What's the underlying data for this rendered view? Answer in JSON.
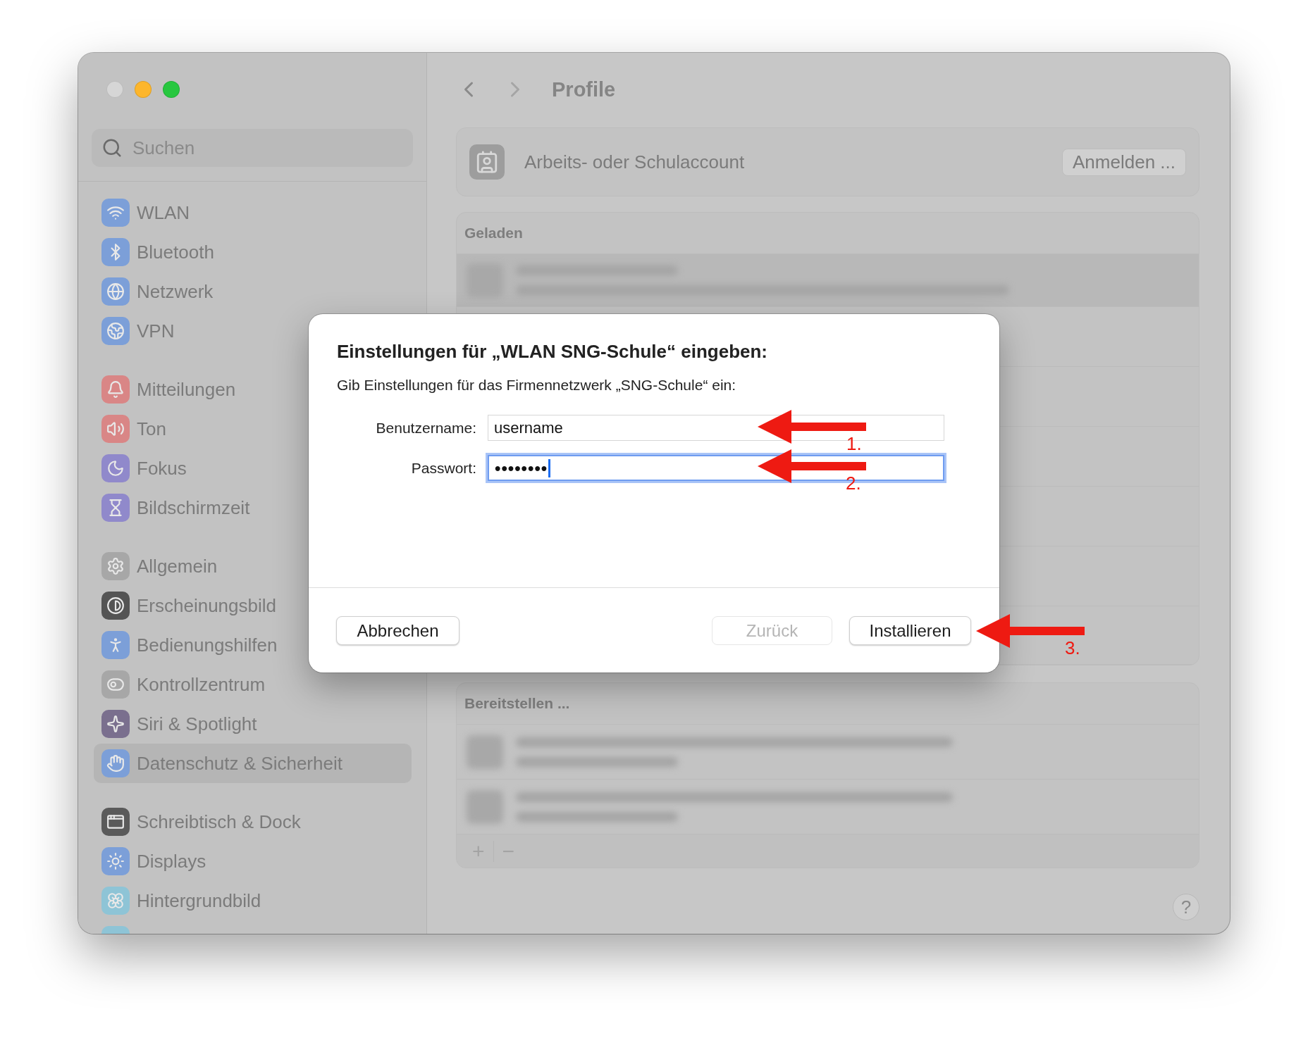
{
  "sidebar": {
    "search": {
      "placeholder": "Suchen"
    },
    "groups": [
      {
        "items": [
          {
            "label": "WLAN",
            "color": "#7c9fd8",
            "selected": false
          },
          {
            "label": "Bluetooth",
            "color": "#7c9fd8",
            "selected": false
          },
          {
            "label": "Netzwerk",
            "color": "#7c9fd8",
            "selected": false
          },
          {
            "label": "VPN",
            "color": "#7c9fd8",
            "selected": false
          }
        ]
      },
      {
        "items": [
          {
            "label": "Mitteilungen",
            "color": "#d98686",
            "selected": false
          },
          {
            "label": "Ton",
            "color": "#d98686",
            "selected": false
          },
          {
            "label": "Fokus",
            "color": "#9089cb",
            "selected": false
          },
          {
            "label": "Bildschirmzeit",
            "color": "#9089cb",
            "selected": false
          }
        ]
      },
      {
        "items": [
          {
            "label": "Allgemein",
            "color": "#a7a7a7",
            "selected": false
          },
          {
            "label": "Erscheinungsbild",
            "color": "#545454",
            "selected": false
          },
          {
            "label": "Bedienungshilfen",
            "color": "#7c9fd8",
            "selected": false
          },
          {
            "label": "Kontrollzentrum",
            "color": "#a7a7a7",
            "selected": false
          },
          {
            "label": "Siri & Spotlight",
            "color": "#7a6f8e",
            "selected": false
          },
          {
            "label": "Datenschutz & Sicherheit",
            "color": "#7c9fd8",
            "selected": true
          }
        ]
      },
      {
        "items": [
          {
            "label": "Schreibtisch & Dock",
            "color": "#5a5a5a",
            "selected": false
          },
          {
            "label": "Displays",
            "color": "#7c9fd8",
            "selected": false
          },
          {
            "label": "Hintergrundbild",
            "color": "#8ec4d6",
            "selected": false
          }
        ]
      }
    ]
  },
  "toolbar": {
    "title": "Profile"
  },
  "account_card": {
    "label": "Arbeits- oder Schulaccount",
    "button": "Anmelden ..."
  },
  "sections": [
    {
      "title": "Geladen"
    },
    {
      "title": "Bereitstellen ..."
    }
  ],
  "list_controls": [
    "+",
    "−"
  ],
  "help_button": "?",
  "dialog": {
    "title": "Einstellungen für „WLAN SNG-Schule“ eingeben:",
    "subtitle": "Gib Einstellungen für das Firmennetzwerk „SNG-Schule“ ein:",
    "fields": [
      {
        "label": "Benutzername:",
        "value": "username",
        "kind": "text",
        "focused": false
      },
      {
        "label": "Passwort:",
        "value": "••••••••",
        "kind": "password",
        "focused": true
      }
    ],
    "buttons": [
      {
        "label": "Abbrechen",
        "disabled": false
      },
      {
        "label": "Zurück",
        "disabled": true
      },
      {
        "label": "Installieren",
        "disabled": false
      }
    ]
  },
  "annotations": [
    {
      "label": "1."
    },
    {
      "label": "2."
    },
    {
      "label": "3."
    }
  ]
}
